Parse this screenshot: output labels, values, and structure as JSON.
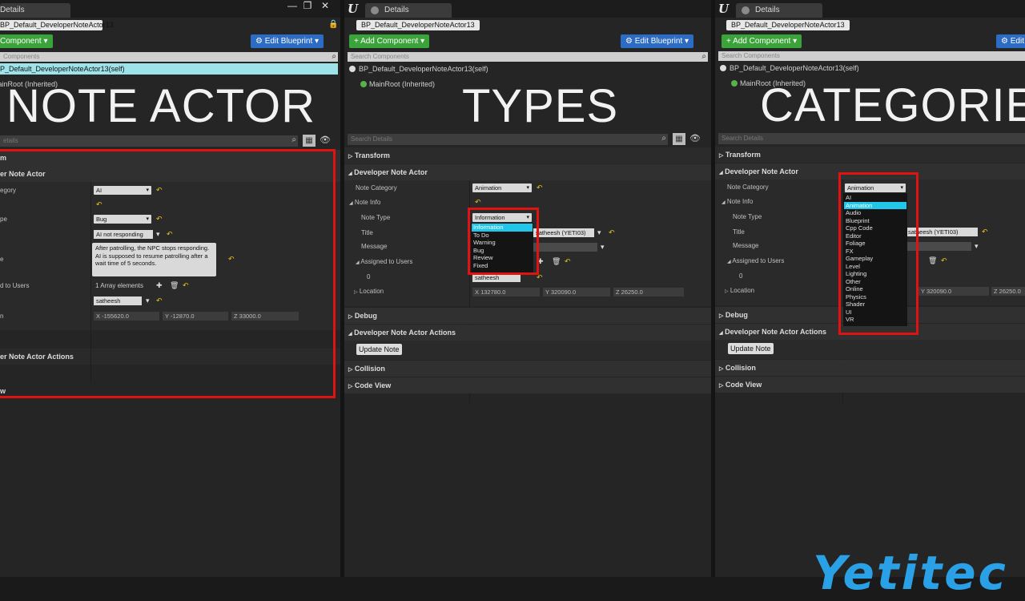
{
  "tab_title": "Details",
  "blueprint_name": "BP_Default_DeveloperNoteActor13",
  "self_entry": "BP_Default_DeveloperNoteActor13(self)",
  "main_root": "MainRoot (Inherited)",
  "add_component": "+ Add Component ▾",
  "add_component_cut": "Component ▾",
  "edit_blueprint": "⚙ Edit Blueprint ▾",
  "search_components": "Search Components",
  "search_components_cut": "Components",
  "search_details": "Search Details",
  "search_details_cut": "etails",
  "window_controls": {
    "minimize": "—",
    "maximize": "❐",
    "close": "✕"
  },
  "panel_labels": {
    "note_actor": "NOTE ACTOR",
    "types": "TYPES",
    "categories": "CATEGORIES"
  },
  "categories_panel": {
    "transform": "Transform",
    "developer_note_actor": "Developer Note Actor",
    "debug": "Debug",
    "developer_note_actor_actions": "Developer Note Actor Actions",
    "collision": "Collision",
    "code_view": "Code View"
  },
  "cut_labels": {
    "transform": "m",
    "developer_note_actor": "er Note Actor",
    "category": "egory",
    "type": "pe",
    "title": "e",
    "assigned": "d to Users",
    "location": "n",
    "actions": "er Note Actor Actions",
    "code_view": "w"
  },
  "property_labels": {
    "note_category": "Note Category",
    "note_info": "Note Info",
    "note_type": "Note Type",
    "title": "Title",
    "message": "Message",
    "assigned_to_users": "Assigned to Users",
    "index_0": "0",
    "location": "Location"
  },
  "values": {
    "category_ai": "AI",
    "category_animation": "Animation",
    "type_bug": "Bug",
    "type_information": "Information",
    "title_value": "AI not responding",
    "title_value_partial": "satheesh (YETI03)",
    "message_value": "After patrolling, the NPC stops responding. AI is supposed to resume patrolling after a wait time of 5 seconds.",
    "array_elements": "1 Array elements",
    "user_0": "satheesh",
    "loc_x1": "X  -155620.0",
    "loc_y1": "Y  -12870.0",
    "loc_z1": "Z  33000.0",
    "loc_x2": "X  132780.0",
    "loc_y2": "Y  320090.0",
    "loc_z2": "Z  26250.0",
    "loc_y3": "Y  320090.0",
    "loc_z3": "Z  26250.0"
  },
  "update_note": "Update Note",
  "type_options": [
    "Information",
    "To Do",
    "Warning",
    "Bug",
    "Review",
    "Fixed"
  ],
  "category_options": [
    "AI",
    "Animation",
    "Audio",
    "Blueprint",
    "Cpp Code",
    "Editor",
    "Foliage",
    "FX",
    "Gameplay",
    "Level",
    "Lighting",
    "Other",
    "Online",
    "Physics",
    "Shader",
    "UI",
    "VR"
  ],
  "logo_text": "Yetitec",
  "icons": {
    "search": "⌕",
    "lock": "🔒",
    "grid": "▦",
    "eye": "👁",
    "reset": "↶",
    "plus": "✚",
    "trash": "🗑",
    "arrow_right": "▷",
    "arrow_down": "◢",
    "arrow": "▾"
  },
  "colors": {
    "add_green": "#3aa33a",
    "edit_blue": "#2c6cc4",
    "highlight_red": "#e01212",
    "selection_cyan": "#22c6e8",
    "reset_yellow": "#e6c31a"
  }
}
